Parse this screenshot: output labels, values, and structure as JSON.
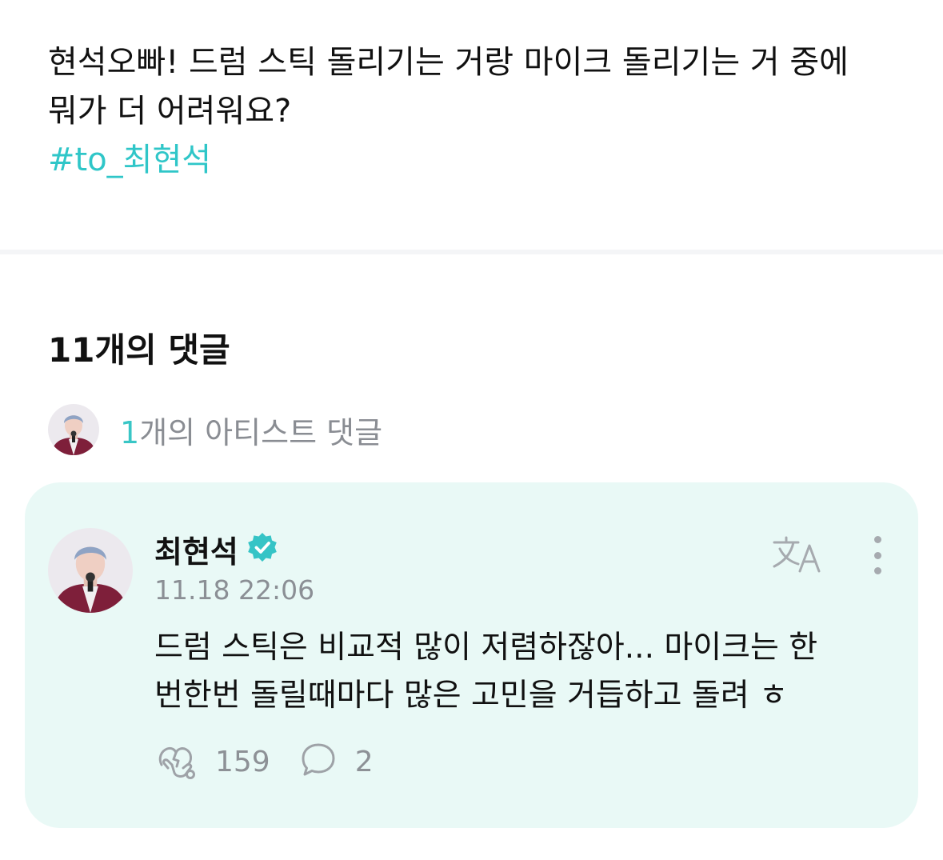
{
  "post": {
    "body": "현석오빠! 드럼 스틱 돌리기는 거랑 마이크 돌리기는 거 중에\n뭐가 더 어려워요?",
    "hashtag": "#to_최현석"
  },
  "comments_header": {
    "count_label": "11개의 댓글"
  },
  "artist_comments": {
    "count": "1",
    "label": "개의 아티스트 댓글"
  },
  "comment": {
    "author": "최현석",
    "verified": true,
    "timestamp": "11.18 22:06",
    "text": "드럼 스틱은 비교적 많이 저렴하잖아... 마이크는 한\n번한번 돌릴때마다 많은 고민을 거듭하고 돌려 ㅎ",
    "likes": "159",
    "replies": "2"
  },
  "colors": {
    "accent": "#2fc6c8",
    "card_background": "#e9f9f6",
    "muted_text": "#8b8f95",
    "verified_badge": "#35c4c6"
  },
  "icons": {
    "translate": "translate-icon",
    "more": "more-vertical-icon",
    "like": "heart-hands-icon",
    "reply": "speech-bubble-icon",
    "verified": "verified-badge-icon"
  }
}
